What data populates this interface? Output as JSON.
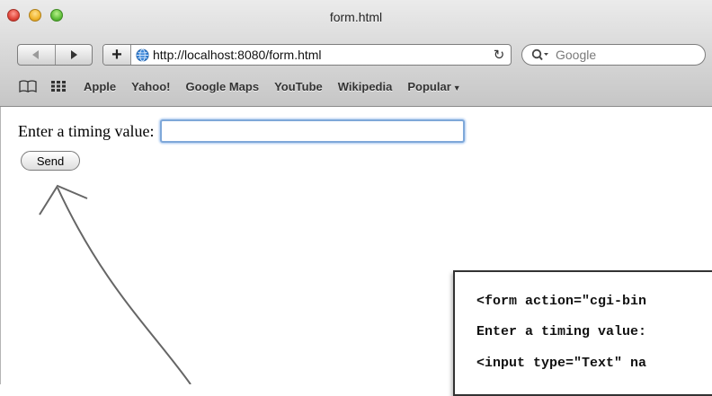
{
  "window": {
    "title": "form.html"
  },
  "toolbar": {
    "url": "http://localhost:8080/form.html",
    "search_placeholder": "Google",
    "plus_label": "+",
    "reload_glyph": "↻"
  },
  "bookmarks": {
    "items": [
      "Apple",
      "Yahoo!",
      "Google Maps",
      "YouTube",
      "Wikipedia",
      "Popular"
    ]
  },
  "page": {
    "prompt": "Enter a timing value:",
    "input_value": "",
    "send_label": "Send"
  },
  "code_snippet": {
    "lines": [
      "<form action=\"cgi-bin",
      "Enter a timing value:",
      "<input type=\"Text\" na"
    ]
  },
  "colors": {
    "input_focus": "#7fa8d9",
    "traffic_close": "#e0453a",
    "traffic_min": "#f0b52d",
    "traffic_zoom": "#5fbe3a"
  }
}
